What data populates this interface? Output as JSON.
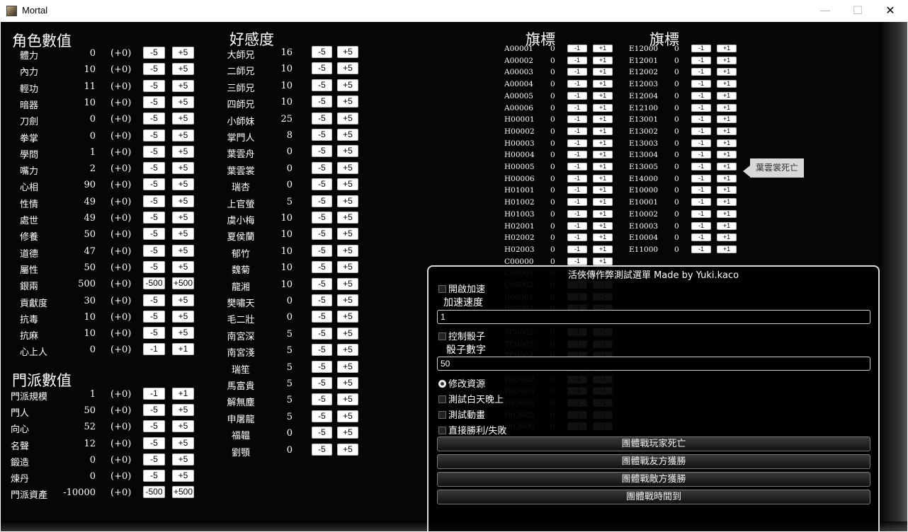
{
  "window": {
    "title": "Mortal",
    "minimize": "—",
    "maximize": "☐",
    "close": "✕"
  },
  "stats": {
    "title": "角色數值",
    "rows": [
      {
        "label": "體力",
        "value": "0",
        "delta": "(+0)",
        "minus": "-5",
        "plus": "+5"
      },
      {
        "label": "內力",
        "value": "10",
        "delta": "(+0)",
        "minus": "-5",
        "plus": "+5"
      },
      {
        "label": "輕功",
        "value": "11",
        "delta": "(+0)",
        "minus": "-5",
        "plus": "+5"
      },
      {
        "label": "暗器",
        "value": "10",
        "delta": "(+0)",
        "minus": "-5",
        "plus": "+5"
      },
      {
        "label": "刀劍",
        "value": "0",
        "delta": "(+0)",
        "minus": "-5",
        "plus": "+5"
      },
      {
        "label": "拳掌",
        "value": "0",
        "delta": "(+0)",
        "minus": "-5",
        "plus": "+5"
      },
      {
        "label": "學問",
        "value": "1",
        "delta": "(+0)",
        "minus": "-5",
        "plus": "+5"
      },
      {
        "label": "嘴力",
        "value": "2",
        "delta": "(+0)",
        "minus": "-5",
        "plus": "+5"
      },
      {
        "label": "心相",
        "value": "90",
        "delta": "(+0)",
        "minus": "-5",
        "plus": "+5"
      },
      {
        "label": "性情",
        "value": "49",
        "delta": "(+0)",
        "minus": "-5",
        "plus": "+5"
      },
      {
        "label": "處世",
        "value": "49",
        "delta": "(+0)",
        "minus": "-5",
        "plus": "+5"
      },
      {
        "label": "修養",
        "value": "50",
        "delta": "(+0)",
        "minus": "-5",
        "plus": "+5"
      },
      {
        "label": "道德",
        "value": "47",
        "delta": "(+0)",
        "minus": "-5",
        "plus": "+5"
      },
      {
        "label": "屬性",
        "value": "50",
        "delta": "(+0)",
        "minus": "-5",
        "plus": "+5"
      },
      {
        "label": "銀兩",
        "value": "500",
        "delta": "(+0)",
        "minus": "-500",
        "plus": "+500"
      },
      {
        "label": "貢獻度",
        "value": "30",
        "delta": "(+0)",
        "minus": "-5",
        "plus": "+5"
      },
      {
        "label": "抗毒",
        "value": "10",
        "delta": "(+0)",
        "minus": "-5",
        "plus": "+5"
      },
      {
        "label": "抗麻",
        "value": "10",
        "delta": "(+0)",
        "minus": "-5",
        "plus": "+5"
      },
      {
        "label": "心上人",
        "value": "0",
        "delta": "(+0)",
        "minus": "-1",
        "plus": "+1"
      }
    ]
  },
  "sect": {
    "title": "門派數值",
    "rows": [
      {
        "label": "門派規模",
        "value": "1",
        "delta": "(+0)",
        "minus": "-1",
        "plus": "+1"
      },
      {
        "label": "門人",
        "value": "50",
        "delta": "(+0)",
        "minus": "-5",
        "plus": "+5"
      },
      {
        "label": "向心",
        "value": "52",
        "delta": "(+0)",
        "minus": "-5",
        "plus": "+5"
      },
      {
        "label": "名聲",
        "value": "12",
        "delta": "(+0)",
        "minus": "-5",
        "plus": "+5"
      },
      {
        "label": "鍛造",
        "value": "0",
        "delta": "(+0)",
        "minus": "-5",
        "plus": "+5"
      },
      {
        "label": "煉丹",
        "value": "0",
        "delta": "(+0)",
        "minus": "-5",
        "plus": "+5"
      },
      {
        "label": "門派資產",
        "value": "-10000",
        "delta": "(+0)",
        "minus": "-500",
        "plus": "+500"
      }
    ]
  },
  "affinity": {
    "title": "好感度",
    "rows": [
      {
        "label": "大師兄",
        "value": "16",
        "minus": "-5",
        "plus": "+5"
      },
      {
        "label": "二師兄",
        "value": "10",
        "minus": "-5",
        "plus": "+5"
      },
      {
        "label": "三師兄",
        "value": "10",
        "minus": "-5",
        "plus": "+5"
      },
      {
        "label": "四師兄",
        "value": "10",
        "minus": "-5",
        "plus": "+5"
      },
      {
        "label": "小師妹",
        "value": "25",
        "minus": "-5",
        "plus": "+5"
      },
      {
        "label": "掌門人",
        "value": "8",
        "minus": "-5",
        "plus": "+5"
      },
      {
        "label": "葉雲舟",
        "value": "0",
        "minus": "-5",
        "plus": "+5"
      },
      {
        "label": "葉雲裳",
        "value": "0",
        "minus": "-5",
        "plus": "+5"
      },
      {
        "label": "瑞杏",
        "value": "0",
        "minus": "-5",
        "plus": "+5"
      },
      {
        "label": "上官螢",
        "value": "5",
        "minus": "-5",
        "plus": "+5"
      },
      {
        "label": "虞小梅",
        "value": "10",
        "minus": "-5",
        "plus": "+5"
      },
      {
        "label": "夏侯蘭",
        "value": "10",
        "minus": "-5",
        "plus": "+5"
      },
      {
        "label": "郁竹",
        "value": "10",
        "minus": "-5",
        "plus": "+5"
      },
      {
        "label": "魏菊",
        "value": "10",
        "minus": "-5",
        "plus": "+5"
      },
      {
        "label": "龍湘",
        "value": "10",
        "minus": "-5",
        "plus": "+5"
      },
      {
        "label": "樊嘯天",
        "value": "0",
        "minus": "-5",
        "plus": "+5"
      },
      {
        "label": "毛二壯",
        "value": "0",
        "minus": "-5",
        "plus": "+5"
      },
      {
        "label": "南宮深",
        "value": "5",
        "minus": "-5",
        "plus": "+5"
      },
      {
        "label": "南宮淺",
        "value": "5",
        "minus": "-5",
        "plus": "+5"
      },
      {
        "label": "瑞笙",
        "value": "5",
        "minus": "-5",
        "plus": "+5"
      },
      {
        "label": "馬富貴",
        "value": "5",
        "minus": "-5",
        "plus": "+5"
      },
      {
        "label": "解無塵",
        "value": "5",
        "minus": "-5",
        "plus": "+5"
      },
      {
        "label": "申屠龍",
        "value": "5",
        "minus": "-5",
        "plus": "+5"
      },
      {
        "label": "福韞",
        "value": "0",
        "minus": "-5",
        "plus": "+5"
      },
      {
        "label": "劉顎",
        "value": "0",
        "minus": "-5",
        "plus": "+5"
      }
    ]
  },
  "flags": {
    "title_left": "旗標",
    "title_right": "旗標",
    "minus": "-1",
    "plus": "+1",
    "left": [
      {
        "code": "A00001",
        "value": "0"
      },
      {
        "code": "A00002",
        "value": "0"
      },
      {
        "code": "A00003",
        "value": "0"
      },
      {
        "code": "A00004",
        "value": "0"
      },
      {
        "code": "A00005",
        "value": "0"
      },
      {
        "code": "A00006",
        "value": "0"
      },
      {
        "code": "H00001",
        "value": "0"
      },
      {
        "code": "H00002",
        "value": "0"
      },
      {
        "code": "H00003",
        "value": "0"
      },
      {
        "code": "H00004",
        "value": "0"
      },
      {
        "code": "H00005",
        "value": "0"
      },
      {
        "code": "H00006",
        "value": "0"
      },
      {
        "code": "H01001",
        "value": "0"
      },
      {
        "code": "H01002",
        "value": "0"
      },
      {
        "code": "H01003",
        "value": "0"
      },
      {
        "code": "H02001",
        "value": "0"
      },
      {
        "code": "H02002",
        "value": "0"
      },
      {
        "code": "H02003",
        "value": "0"
      },
      {
        "code": "C00000",
        "value": "0"
      },
      {
        "code": "C00001",
        "value": "0"
      },
      {
        "code": "C00002",
        "value": "0"
      },
      {
        "code": "B00001",
        "value": "0"
      },
      {
        "code": "B00002",
        "value": "0"
      },
      {
        "code": "TC0001",
        "value": "0"
      },
      {
        "code": "TC0002",
        "value": "0"
      },
      {
        "code": "TC0003",
        "value": "0"
      },
      {
        "code": "TC0004",
        "value": "0"
      },
      {
        "code": "H03001",
        "value": "0"
      },
      {
        "code": "H03002",
        "value": "0"
      },
      {
        "code": "H03003",
        "value": "0"
      },
      {
        "code": "H03004",
        "value": "0"
      },
      {
        "code": "H03005",
        "value": "0"
      },
      {
        "code": "H03006",
        "value": "0"
      }
    ],
    "right": [
      {
        "code": "E12000",
        "value": "0"
      },
      {
        "code": "E12001",
        "value": "0"
      },
      {
        "code": "E12002",
        "value": "0"
      },
      {
        "code": "E12003",
        "value": "0"
      },
      {
        "code": "E12004",
        "value": "0"
      },
      {
        "code": "E12100",
        "value": "0"
      },
      {
        "code": "E13001",
        "value": "0"
      },
      {
        "code": "E13002",
        "value": "0"
      },
      {
        "code": "E13003",
        "value": "0"
      },
      {
        "code": "E13004",
        "value": "0"
      },
      {
        "code": "E13005",
        "value": "0"
      },
      {
        "code": "E14000",
        "value": "0"
      },
      {
        "code": "E10000",
        "value": "0"
      },
      {
        "code": "E10001",
        "value": "0"
      },
      {
        "code": "E10002",
        "value": "0"
      },
      {
        "code": "E10003",
        "value": "0"
      },
      {
        "code": "E10004",
        "value": "0"
      },
      {
        "code": "E11000",
        "value": "0"
      }
    ],
    "tooltip": "葉雲裳死亡"
  },
  "cheat_panel": {
    "title": "活俠傳作弊測試選單 Made by Yuki.kaco",
    "speed_toggle": "開啟加速",
    "speed_label": "加速速度",
    "speed_value": "1",
    "dice_toggle": "控制骰子",
    "dice_label": "骰子數字",
    "dice_value": "50",
    "resource_radio": "修改資源",
    "daynight_toggle": "測試白天晚上",
    "animation_toggle": "測試動畫",
    "winlose_toggle": "直接勝利/失敗",
    "buttons": [
      "團體戰玩家死亡",
      "團體戰友方獲勝",
      "團體戰敵方獲勝",
      "團體戰時間到"
    ]
  }
}
